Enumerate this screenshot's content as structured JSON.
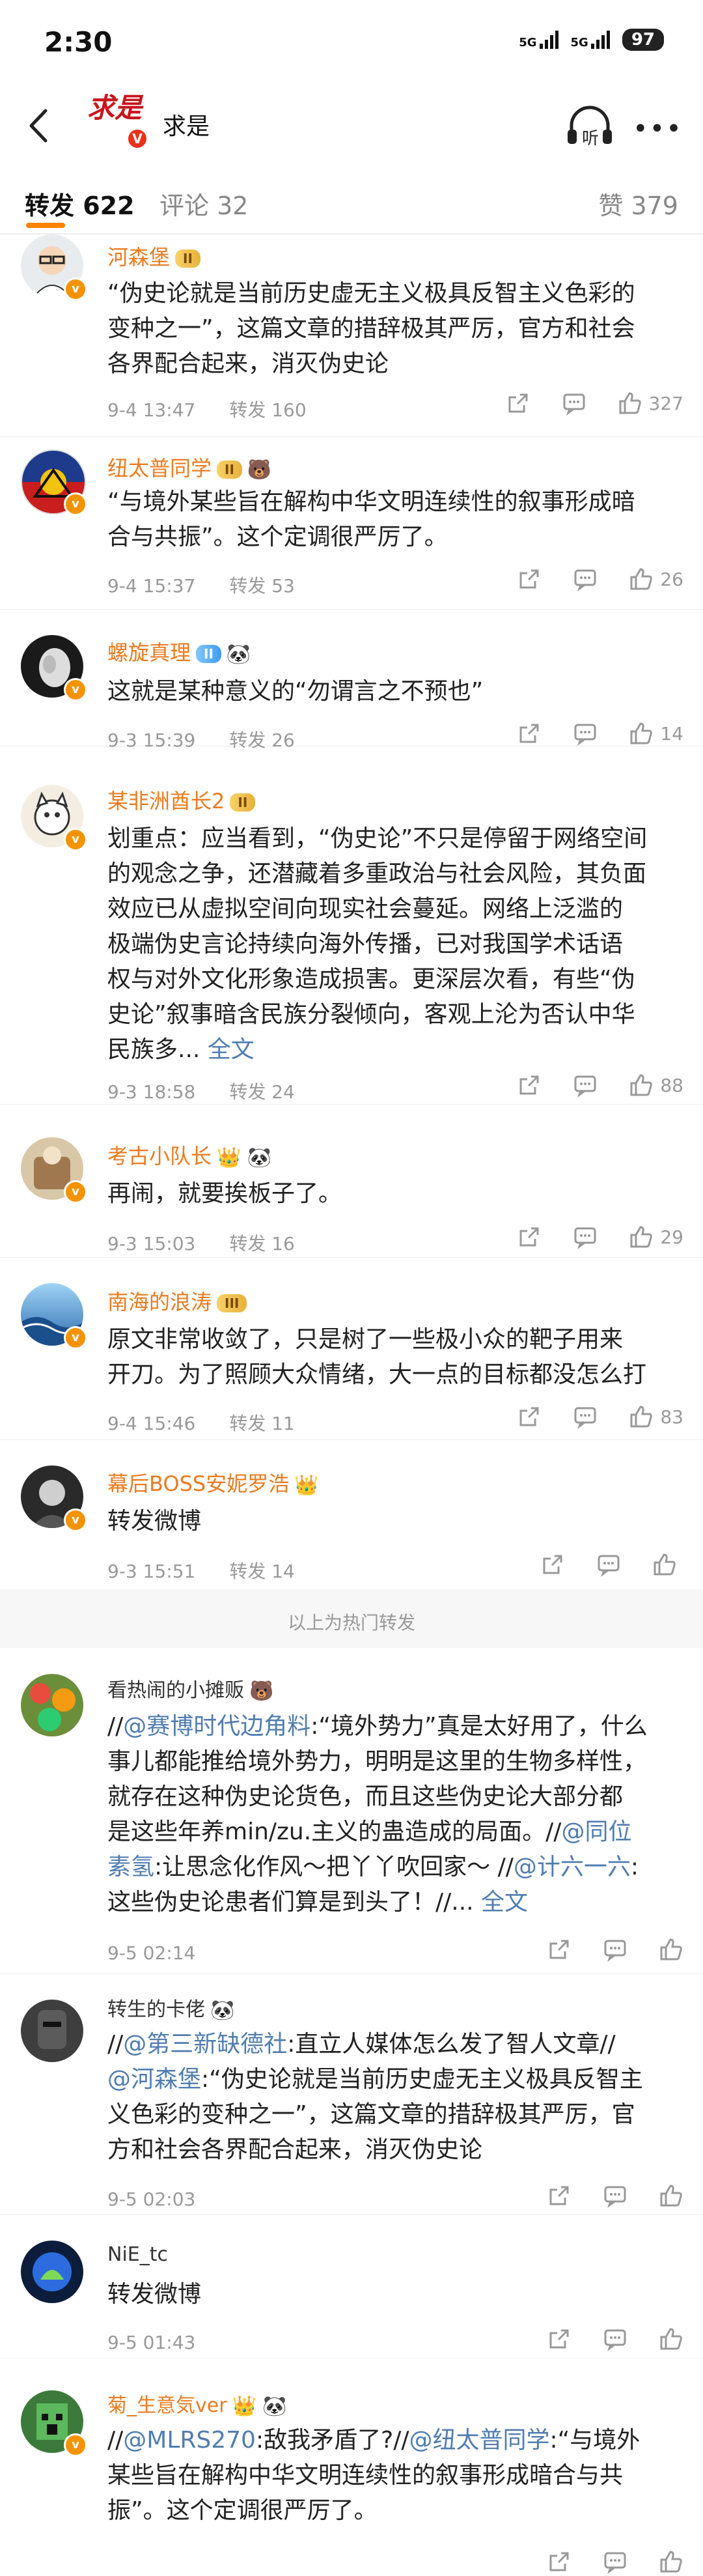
{
  "status_bar": {
    "time": "2:30",
    "net1": "5G",
    "net2": "5G",
    "battery": "97"
  },
  "nav": {
    "title": "求是",
    "logo_text": "求是"
  },
  "tabs": {
    "forward": "转发 622",
    "comment": "评论 32",
    "like": "赞 379"
  },
  "hot_divider": "以上为热门转发",
  "colors": {
    "accent": "#ff8200",
    "vip_name": "#eb7b1f",
    "link": "#507daf"
  },
  "posts": [
    {
      "name": "河森堡",
      "lv": "II",
      "lines": [
        "“伪史论就是当前历史虚无主义极具反智主义色彩的",
        "变种之一”，这篇文章的措辞极其严厉，官方和社会",
        "各界配合起来，消灭伪史论"
      ],
      "time": "9-4 13:47",
      "fwd": "转发 160",
      "likes": "327"
    },
    {
      "name": "纽太普同学",
      "lv": "II",
      "emoji": "🐻",
      "lines": [
        "“与境外某些旨在解构中华文明连续性的叙事形成暗",
        "合与共振”。这个定调很严厉了。"
      ],
      "time": "9-4 15:37",
      "fwd": "转发 53",
      "likes": "26"
    },
    {
      "name": "螺旋真理",
      "lv": "II",
      "emoji": "🐼",
      "lines": [
        "这就是某种意义的“勿谓言之不预也”"
      ],
      "time": "9-3 15:39",
      "fwd": "转发 26",
      "likes": "14"
    },
    {
      "name": "某非洲酋长2",
      "lv": "II",
      "lines": [
        "划重点：应当看到，“伪史论”不只是停留于网络空间",
        "的观念之争，还潜藏着多重政治与社会风险，其负面",
        "效应已从虚拟空间向现实社会蔓延。网络上泛滥的",
        "极端伪史言论持续向海外传播，已对我国学术话语",
        "权与对外文化形象造成损害。更深层次看，有些“伪",
        "史论”叙事暗含民族分裂倾向，客观上沦为否认中华"
      ],
      "last": "民族多...",
      "full": " 全文",
      "time": "9-3 18:58",
      "fwd": "转发 24",
      "likes": "88"
    },
    {
      "name": "考古小队长",
      "emoji": "👑 🐼",
      "lines": [
        "再闹，就要挨板子了。"
      ],
      "time": "9-3 15:03",
      "fwd": "转发 16",
      "likes": "29"
    },
    {
      "name": "南海的浪涛",
      "lv": "III",
      "lines": [
        "原文非常收敛了，只是树了一些极小众的靶子用来",
        "开刀。为了照顾大众情绪，大一点的目标都没怎么打"
      ],
      "time": "9-4 15:46",
      "fwd": "转发 11",
      "likes": "83"
    },
    {
      "name": "幕后BOSS安妮罗浩",
      "emoji": "👑",
      "lines": [
        "转发微博"
      ],
      "time": "9-3 15:51",
      "fwd": "转发 14",
      "likes": ""
    },
    {
      "name": "看热闹的小摊贩",
      "emoji": "🐻",
      "l1a": "//",
      "l1b": "@赛博时代边角料",
      "l1c": ":“境外势力”真是太好用了，什么",
      "plain": [
        "事儿都能推给境外势力，明明是这里的生物多样性，",
        "就存在这种伪史论货色，而且这些伪史论大部分都"
      ],
      "l4a": "是这些年养min/zu.主义的蛊造成的局面。//",
      "l4b": "@同位",
      "l5a": "素氢",
      "l5b": ":让思念化作风～把丫丫吹回家～ //",
      "l5c": "@计六一六",
      "l5d": ":",
      "l6a": "这些伪史论患者们算是到头了！//... ",
      "l6b": "全文",
      "time": "9-5 02:14",
      "fwd": "",
      "likes": ""
    },
    {
      "name": "转生的卡佬",
      "emoji": "🐼",
      "l1a": "//",
      "l1b": "@第三新缺德社",
      "l1c": ":直立人媒体怎么发了智人文章//",
      "l2a": "@河森堡",
      "l2b": ":“伪史论就是当前历史虚无主义极具反智主",
      "plain": [
        "义色彩的变种之一”，这篇文章的措辞极其严厉，官",
        "方和社会各界配合起来，消灭伪史论"
      ],
      "time": "9-5 02:03",
      "fwd": "",
      "likes": ""
    },
    {
      "name": "NiE_tc",
      "lines": [
        "转发微博"
      ],
      "time": "9-5 01:43",
      "fwd": "",
      "likes": ""
    },
    {
      "name": "菊_生意気ver",
      "emoji": "👑 🐼",
      "l1a": "//",
      "l1b": "@MLRS270",
      "l1c": ":敌我矛盾了?//",
      "l1d": "@纽太普同学",
      "l1e": ":“与境外",
      "plain": [
        "某些旨在解构中华文明连续性的叙事形成暗合与共",
        "振”。这个定调很严厉了。"
      ],
      "time": "",
      "fwd": "",
      "likes": ""
    }
  ]
}
